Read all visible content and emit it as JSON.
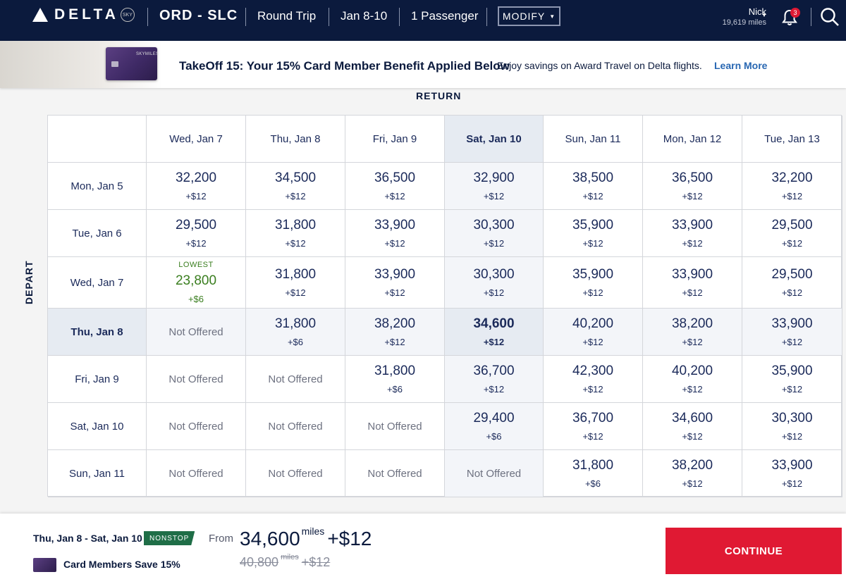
{
  "header": {
    "brand": "DELTA",
    "brand_badge": "SKY",
    "route": "ORD - SLC",
    "trip_type": "Round Trip",
    "dates": "Jan 8-10",
    "passengers": "1 Passenger",
    "modify_label": "MODIFY",
    "user_name": "Nick",
    "user_miles": "19,619 miles",
    "notification_count": "3",
    "icons": [
      "delta-widget-icon",
      "chevron-down-icon",
      "bell-icon",
      "search-icon"
    ]
  },
  "promo": {
    "card_brand": "SKYMILES",
    "title": "TakeOff 15: Your 15% Card Member Benefit Applied Below",
    "text": "Enjoy savings on Award Travel on Delta flights.",
    "link": "Learn More"
  },
  "grid": {
    "return_label": "RETURN",
    "depart_label": "DEPART",
    "return_dates": [
      "Wed, Jan 7",
      "Thu, Jan 8",
      "Fri, Jan 9",
      "Sat, Jan 10",
      "Sun, Jan 11",
      "Mon, Jan 12",
      "Tue, Jan 13"
    ],
    "selected_return_index": 3,
    "lowest_label": "LOWEST",
    "not_offered_label": "Not Offered",
    "rows": [
      {
        "depart": "Mon, Jan 5",
        "cells": [
          {
            "price": "32,200",
            "fee": "+$12"
          },
          {
            "price": "34,500",
            "fee": "+$12"
          },
          {
            "price": "36,500",
            "fee": "+$12"
          },
          {
            "price": "32,900",
            "fee": "+$12"
          },
          {
            "price": "38,500",
            "fee": "+$12"
          },
          {
            "price": "36,500",
            "fee": "+$12"
          },
          {
            "price": "32,200",
            "fee": "+$12"
          }
        ]
      },
      {
        "depart": "Tue, Jan 6",
        "cells": [
          {
            "price": "29,500",
            "fee": "+$12"
          },
          {
            "price": "31,800",
            "fee": "+$12"
          },
          {
            "price": "33,900",
            "fee": "+$12"
          },
          {
            "price": "30,300",
            "fee": "+$12"
          },
          {
            "price": "35,900",
            "fee": "+$12"
          },
          {
            "price": "33,900",
            "fee": "+$12"
          },
          {
            "price": "29,500",
            "fee": "+$12"
          }
        ]
      },
      {
        "depart": "Wed, Jan 7",
        "cells": [
          {
            "price": "23,800",
            "fee": "+$6",
            "lowest": true
          },
          {
            "price": "31,800",
            "fee": "+$12"
          },
          {
            "price": "33,900",
            "fee": "+$12"
          },
          {
            "price": "30,300",
            "fee": "+$12"
          },
          {
            "price": "35,900",
            "fee": "+$12"
          },
          {
            "price": "33,900",
            "fee": "+$12"
          },
          {
            "price": "29,500",
            "fee": "+$12"
          }
        ]
      },
      {
        "depart": "Thu, Jan 8",
        "selected": true,
        "cells": [
          null,
          {
            "price": "31,800",
            "fee": "+$6"
          },
          {
            "price": "38,200",
            "fee": "+$12"
          },
          {
            "price": "34,600",
            "fee": "+$12",
            "selected": true
          },
          {
            "price": "40,200",
            "fee": "+$12"
          },
          {
            "price": "38,200",
            "fee": "+$12"
          },
          {
            "price": "33,900",
            "fee": "+$12"
          }
        ]
      },
      {
        "depart": "Fri, Jan 9",
        "cells": [
          null,
          null,
          {
            "price": "31,800",
            "fee": "+$6"
          },
          {
            "price": "36,700",
            "fee": "+$12"
          },
          {
            "price": "42,300",
            "fee": "+$12"
          },
          {
            "price": "40,200",
            "fee": "+$12"
          },
          {
            "price": "35,900",
            "fee": "+$12"
          }
        ]
      },
      {
        "depart": "Sat, Jan 10",
        "cells": [
          null,
          null,
          null,
          {
            "price": "29,400",
            "fee": "+$6"
          },
          {
            "price": "36,700",
            "fee": "+$12"
          },
          {
            "price": "34,600",
            "fee": "+$12"
          },
          {
            "price": "30,300",
            "fee": "+$12"
          }
        ]
      },
      {
        "depart": "Sun, Jan 11",
        "cells": [
          null,
          null,
          null,
          null,
          {
            "price": "31,800",
            "fee": "+$6"
          },
          {
            "price": "38,200",
            "fee": "+$12"
          },
          {
            "price": "33,900",
            "fee": "+$12"
          }
        ]
      }
    ]
  },
  "footer": {
    "trip_dates": "Thu, Jan 8 - Sat, Jan 10",
    "nonstop_label": "NONSTOP",
    "card_save": "Card Members Save 15%",
    "from_label": "From",
    "total_miles": "34,600",
    "miles_unit": "miles",
    "total_tax": "+$12",
    "old_miles": "40,800",
    "old_tax": "+$12",
    "continue_label": "CONTINUE"
  },
  "colors": {
    "nav_bg": "#0b1a3d",
    "accent_red": "#e01933",
    "lowest_green": "#3a7e1f",
    "nonstop_green": "#1f6e47",
    "link_blue": "#2867b2",
    "selected_bg": "#e6ebf2"
  }
}
